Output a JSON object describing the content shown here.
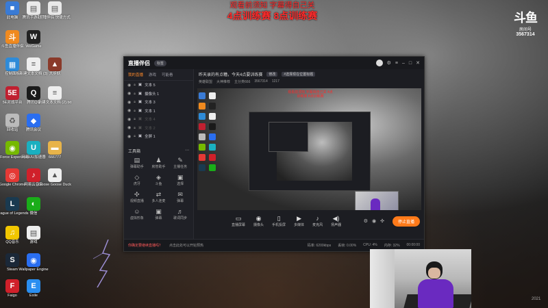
{
  "overlay": {
    "line1": "观看前须知 字幕得自己关",
    "line2": "4点训练赛  8点训练赛"
  },
  "douyu": {
    "logo": "斗鱼",
    "label": "房间号",
    "room": "3567314"
  },
  "desktop_icons": [
    {
      "label": "此电脑",
      "icon": "computer-icon",
      "color": "#3a7bd5",
      "glyph": "■"
    },
    {
      "label": "腾讯手游助手",
      "icon": "file-icon",
      "color": "#e9e9e9",
      "glyph": "▤"
    },
    {
      "label": "主播伴侣 快捷方式",
      "icon": "file-icon",
      "color": "#e9e9e9",
      "glyph": "▤"
    },
    {
      "label": "斗鱼直播伴侣",
      "icon": "douyu-icon",
      "color": "#f08a1f",
      "glyph": "斗"
    },
    {
      "label": "WeGame",
      "icon": "wegame-icon",
      "color": "#222",
      "glyph": "W"
    },
    {
      "label": "控制面板",
      "icon": "control-panel-icon",
      "color": "#2e8bd8",
      "glyph": "▦"
    },
    {
      "label": "新建文本文档 (3)",
      "icon": "text-file-icon",
      "color": "#eee",
      "glyph": "≡"
    },
    {
      "label": "大步妖",
      "icon": "game-icon",
      "color": "#8a3a2a",
      "glyph": "▲"
    },
    {
      "label": "5E对战平台",
      "icon": "5e-icon",
      "color": "#c02030",
      "glyph": "5E"
    },
    {
      "label": "腾讯QQ",
      "icon": "qq-icon",
      "color": "#1a1a1a",
      "glyph": "Q"
    },
    {
      "label": "新建文本文档 (2).txt",
      "icon": "text-file-icon",
      "color": "#eee",
      "glyph": "≡"
    },
    {
      "label": "回收站",
      "icon": "recycle-bin-icon",
      "color": "#bbb",
      "glyph": "♻"
    },
    {
      "label": "腾讯会议",
      "icon": "meeting-icon",
      "color": "#2a6ef0",
      "glyph": "◆"
    },
    {
      "label": "GeForce Experience",
      "icon": "nvidia-icon",
      "color": "#76b900",
      "glyph": "◉"
    },
    {
      "label": "网易UU加速器",
      "icon": "uu-icon",
      "color": "#1ab0c0",
      "glyph": "U"
    },
    {
      "label": "666777",
      "icon": "folder-icon",
      "color": "#e8b44a",
      "glyph": "▬"
    },
    {
      "label": "Google Chrome",
      "icon": "chrome-icon",
      "color": "#e53935",
      "glyph": "◎"
    },
    {
      "label": "网易云音乐",
      "icon": "netease-music-icon",
      "color": "#d0202a",
      "glyph": "♪"
    },
    {
      "label": "Goose Goose Duck",
      "icon": "goose-icon",
      "color": "#eee",
      "glyph": "▲"
    },
    {
      "label": "League of Legends",
      "icon": "lol-icon",
      "color": "#1a3a50",
      "glyph": "L"
    },
    {
      "label": "微信",
      "icon": "wechat-icon",
      "color": "#1aad19",
      "glyph": "◐"
    },
    {
      "label": "QQ音乐",
      "icon": "qq-music-icon",
      "color": "#f2c700",
      "glyph": "♫"
    },
    {
      "label": "游戏",
      "icon": "file-icon",
      "color": "#eee",
      "glyph": "▤"
    },
    {
      "label": "Steam",
      "icon": "steam-icon",
      "color": "#1b2838",
      "glyph": "S"
    },
    {
      "label": "Wallpaper Engine",
      "icon": "wallpaper-engine-icon",
      "color": "#2a6ef0",
      "glyph": "◉"
    },
    {
      "label": "Faigo",
      "icon": "faigo-icon",
      "color": "#d0202a",
      "glyph": "F"
    },
    {
      "label": "Exile",
      "icon": "exile-icon",
      "color": "#2a8ef0",
      "glyph": "E"
    }
  ],
  "app": {
    "logo": "直播伴侣",
    "badge": "标签",
    "tabs": [
      "我的直播",
      "游戏",
      "可能看"
    ],
    "sources": [
      {
        "label": "文本 5",
        "dim": false
      },
      {
        "label": "摄像头 1",
        "dim": false
      },
      {
        "label": "文本 3",
        "dim": false
      },
      {
        "label": "文本 1",
        "dim": false
      },
      {
        "label": "文本 4",
        "dim": true
      },
      {
        "label": "文本 2",
        "dim": true
      },
      {
        "label": "全屏 1",
        "dim": false
      }
    ],
    "tools_title": "工具箱",
    "tools": [
      {
        "label": "弹幕助手",
        "icon": "danmaku-icon",
        "glyph": "▤"
      },
      {
        "label": "房管助手",
        "icon": "manager-icon",
        "glyph": "♟"
      },
      {
        "label": "主播任务",
        "icon": "task-icon",
        "glyph": "✎"
      },
      {
        "label": "虎牙",
        "icon": "tool-icon",
        "glyph": "◇"
      },
      {
        "label": "斗鱼",
        "icon": "tool-icon",
        "glyph": "◈"
      },
      {
        "label": "选择",
        "icon": "tool-icon",
        "glyph": "▣"
      },
      {
        "label": "视频直播",
        "icon": "video-icon",
        "glyph": "✣"
      },
      {
        "label": "多人连麦",
        "icon": "link-icon",
        "glyph": "⇄"
      },
      {
        "label": "弹幕",
        "icon": "chat-icon",
        "glyph": "✉"
      },
      {
        "label": "虚拟形象",
        "icon": "avatar-icon",
        "glyph": "☺"
      },
      {
        "label": "弹幕",
        "icon": "chat-icon",
        "glyph": "▣"
      },
      {
        "label": "歌词同步",
        "icon": "lyrics-icon",
        "glyph": "♬"
      }
    ],
    "info1_text": "昨天录的有点糟，今天4点要训练赛",
    "info1_tag": "修改",
    "info1_tag2": "#选择现在位置标题",
    "info2": [
      "英雄联盟",
      "大神推荐",
      "主分类666",
      "3567314",
      "1217"
    ],
    "preview_title": "观看前须知 字幕得自己关 4点训练赛 8点训练赛",
    "controls": [
      {
        "label": "直播屏幕",
        "icon": "screen-icon",
        "glyph": "▭"
      },
      {
        "label": "摄像头",
        "icon": "camera-icon",
        "glyph": "◉"
      },
      {
        "label": "手机投屏",
        "icon": "phone-icon",
        "glyph": "▯"
      },
      {
        "label": "多媒体",
        "icon": "media-icon",
        "glyph": "▶"
      },
      {
        "label": "麦克风",
        "icon": "mic-icon",
        "glyph": "♪"
      },
      {
        "label": "扬声器",
        "icon": "speaker-icon",
        "glyph": "◀)"
      }
    ],
    "live_button": "停止直播",
    "status_warn": "你确定要继续直播吗？",
    "status_hint": "点击此处可以开始预热",
    "status_right": [
      "码率: 6200kbps",
      "丢帧: 0.00%",
      "CPU: 4%",
      "内存: 32%",
      "00:00:00"
    ]
  },
  "dist_tag": "2021"
}
